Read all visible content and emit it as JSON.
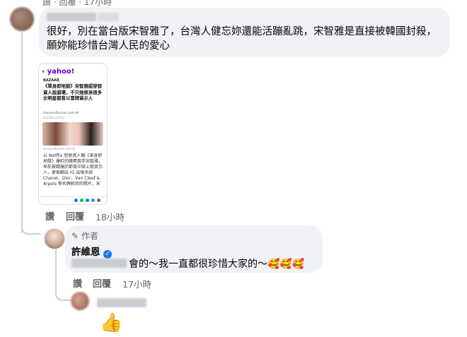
{
  "top": {
    "partial_actions": "讚 · 回覆 · 17小時"
  },
  "comment1": {
    "author": "",
    "text": "很好，別在當台版宋智雅了，台灣人健忘妳還能活蹦亂跳，宋智雅是直接被韓國封殺，願妳能珍惜台灣人民的愛心",
    "like": "讚",
    "reply": "回覆",
    "time": "18小時"
  },
  "screenshot": {
    "brand": "yahoo!",
    "tag": "BAZAAR",
    "headline": "《單身即地獄》宋智雅認穿假貨人設崩壞，不只她原來很多女明星都曾以冒牌貨示人",
    "source": "HarpersBazaar.com.hk",
    "date": "2022年1月24日",
    "credit": "HarpersBazaar.com.hk",
    "body": "以 Netflix 戀愛真人騷《單身即地獄》爆紅的韓素兩手宋智雅，早前被踢爆於節目中穿上假貨示人，更被翻出 IG 出現多款 Chanel、Dior、Van Cleef & Arpels 等名牌假貨的照片，宋"
  },
  "reply": {
    "badge": "作者",
    "author": "許維恩",
    "text": "會的～我一直都很珍惜大家的～",
    "emojis": "🥰🥰🥰",
    "like": "讚",
    "reply": "回覆",
    "time": "17小時"
  },
  "comment3": {
    "emoji": "👍"
  },
  "colors": {
    "bubble": "#f0f2f5",
    "meta": "#65676b",
    "verified": "#1877f2",
    "yahoo": "#6001d2"
  }
}
